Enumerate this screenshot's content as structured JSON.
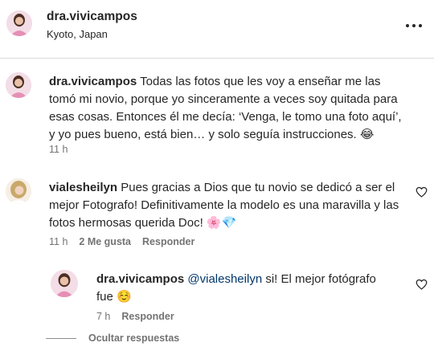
{
  "header": {
    "username": "dra.vivicampos",
    "location": "Kyoto, Japan"
  },
  "comments": [
    {
      "username": "dra.vivicampos",
      "text": "Todas las fotos que les voy a enseñar me las tomó mi novio, porque yo sinceramente a veces soy quitada para esas cosas. Entonces él me decía: ‘Venga, le tomo una foto aquí’, y yo pues bueno, está bien… y solo seguía instrucciones. 😂",
      "time": "11 h"
    },
    {
      "username": "vialesheilyn",
      "text": "Pues gracias a Dios que tu novio se dedicó a ser el mejor Fotografo! Definitivamente la modelo es una maravilla y las fotos hermosas querida Doc! 🌸💎",
      "time": "11 h",
      "likes": "2 Me gusta",
      "reply_label": "Responder"
    }
  ],
  "reply": {
    "username": "dra.vivicampos",
    "mention": "@vialesheilyn",
    "text": " si! El mejor fotógrafo fue ☺️",
    "time": "7 h",
    "reply_label": "Responder"
  },
  "hide_replies": "Ocultar respuestas",
  "colors": {
    "text": "#262626",
    "secondary": "#737373",
    "mention": "#00376b",
    "divider": "#dbdbdb"
  },
  "icons": [
    "more-options-icon",
    "heart-icon"
  ]
}
